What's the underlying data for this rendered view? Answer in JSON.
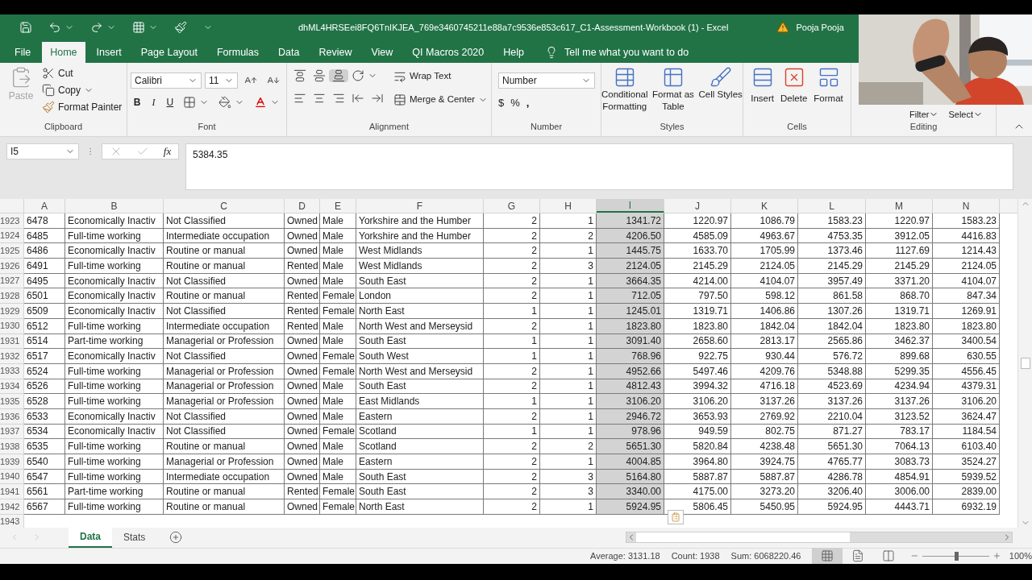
{
  "window": {
    "title": "dhML4HRSEei8FQ6TnIKJEA_769e3460745211e88a7c9536e853c617_C1-Assessment-Workbook (1)  -  Excel",
    "user": "Pooja Pooja"
  },
  "ribbon_tabs": [
    {
      "label": "File",
      "selected": false
    },
    {
      "label": "Home",
      "selected": true
    },
    {
      "label": "Insert",
      "selected": false
    },
    {
      "label": "Page Layout",
      "selected": false
    },
    {
      "label": "Formulas",
      "selected": false
    },
    {
      "label": "Data",
      "selected": false
    },
    {
      "label": "Review",
      "selected": false
    },
    {
      "label": "View",
      "selected": false
    },
    {
      "label": "QI Macros 2020",
      "selected": false
    },
    {
      "label": "Help",
      "selected": false
    }
  ],
  "tell_me": "Tell me what you want to do",
  "clipboard": {
    "paste": {
      "label": "Paste",
      "disabled": true
    },
    "cut": "Cut",
    "copy": "Copy",
    "format_painter": "Format Painter",
    "label": "Clipboard"
  },
  "font": {
    "family": "Calibri",
    "size": "11",
    "bold": "B",
    "italic": "I",
    "underline": "U",
    "label": "Font"
  },
  "alignment": {
    "wrap": "Wrap Text",
    "merge": "Merge & Center",
    "label": "Alignment"
  },
  "number": {
    "format": "Number",
    "currency": "$",
    "percent": "%",
    "comma": ",",
    "label": "Number"
  },
  "styles": {
    "buttons": [
      "Conditional Formatting",
      "Format as Table",
      "Cell Styles"
    ],
    "label": "Styles"
  },
  "cells": {
    "buttons": [
      "Insert",
      "Delete",
      "Format"
    ],
    "label": "Cells"
  },
  "editing": {
    "buttons": [
      "Filter",
      "Select"
    ],
    "label": "Editing"
  },
  "formula_bar": {
    "name_box": "I5",
    "fx": "fx",
    "value": "5384.35"
  },
  "columns": [
    {
      "label": "A",
      "kind": "text",
      "selected": false
    },
    {
      "label": "B",
      "kind": "text",
      "selected": false
    },
    {
      "label": "C",
      "kind": "text",
      "selected": false
    },
    {
      "label": "D",
      "kind": "text",
      "selected": false
    },
    {
      "label": "E",
      "kind": "text",
      "selected": false
    },
    {
      "label": "F",
      "kind": "text",
      "selected": false
    },
    {
      "label": "G",
      "kind": "number",
      "selected": false
    },
    {
      "label": "H",
      "kind": "number",
      "selected": false
    },
    {
      "label": "I",
      "kind": "number",
      "selected": true
    },
    {
      "label": "J",
      "kind": "number",
      "selected": false
    },
    {
      "label": "K",
      "kind": "number",
      "selected": false
    },
    {
      "label": "L",
      "kind": "number",
      "selected": false
    },
    {
      "label": "M",
      "kind": "number",
      "selected": false
    },
    {
      "label": "N",
      "kind": "number",
      "selected": false
    }
  ],
  "rows": [
    {
      "number": "1923",
      "cells": [
        "6478",
        "Economically Inactiv",
        "Not Classified",
        "Owned",
        "Male",
        "Yorkshire and the Humber",
        "2",
        "1",
        "1341.72",
        "1220.97",
        "1086.79",
        "1583.23",
        "1220.97",
        "1583.23"
      ]
    },
    {
      "number": "1924",
      "cells": [
        "6485",
        "Full-time working",
        "Intermediate occupation",
        "Owned",
        "Male",
        "Yorkshire and the Humber",
        "2",
        "2",
        "4206.50",
        "4585.09",
        "4963.67",
        "4753.35",
        "3912.05",
        "4416.83"
      ]
    },
    {
      "number": "1925",
      "cells": [
        "6486",
        "Economically Inactiv",
        "Routine or manual",
        "Owned",
        "Male",
        "West Midlands",
        "2",
        "1",
        "1445.75",
        "1633.70",
        "1705.99",
        "1373.46",
        "1127.69",
        "1214.43"
      ]
    },
    {
      "number": "1926",
      "cells": [
        "6491",
        "Full-time working",
        "Routine or manual",
        "Rented",
        "Male",
        "West Midlands",
        "2",
        "3",
        "2124.05",
        "2145.29",
        "2124.05",
        "2145.29",
        "2145.29",
        "2124.05"
      ]
    },
    {
      "number": "1927",
      "cells": [
        "6495",
        "Economically Inactiv",
        "Not Classified",
        "Owned",
        "Male",
        "South East",
        "2",
        "1",
        "3664.35",
        "4214.00",
        "4104.07",
        "3957.49",
        "3371.20",
        "4104.07"
      ]
    },
    {
      "number": "1928",
      "cells": [
        "6501",
        "Economically Inactiv",
        "Routine or manual",
        "Rented",
        "Female",
        "London",
        "2",
        "1",
        "712.05",
        "797.50",
        "598.12",
        "861.58",
        "868.70",
        "847.34"
      ]
    },
    {
      "number": "1929",
      "cells": [
        "6509",
        "Economically Inactiv",
        "Not Classified",
        "Rented",
        "Female",
        "North East",
        "1",
        "1",
        "1245.01",
        "1319.71",
        "1406.86",
        "1307.26",
        "1319.71",
        "1269.91"
      ]
    },
    {
      "number": "1930",
      "cells": [
        "6512",
        "Full-time working",
        "Intermediate occupation",
        "Rented",
        "Male",
        "North West and Merseysid",
        "2",
        "1",
        "1823.80",
        "1823.80",
        "1842.04",
        "1842.04",
        "1823.80",
        "1823.80"
      ]
    },
    {
      "number": "1931",
      "cells": [
        "6514",
        "Part-time working",
        "Managerial or Profession",
        "Owned",
        "Male",
        "South East",
        "1",
        "1",
        "3091.40",
        "2658.60",
        "2813.17",
        "2565.86",
        "3462.37",
        "3400.54"
      ]
    },
    {
      "number": "1932",
      "cells": [
        "6517",
        "Economically Inactiv",
        "Not Classified",
        "Owned",
        "Female",
        "South West",
        "1",
        "1",
        "768.96",
        "922.75",
        "930.44",
        "576.72",
        "899.68",
        "630.55"
      ]
    },
    {
      "number": "1933",
      "cells": [
        "6524",
        "Full-time working",
        "Managerial or Profession",
        "Owned",
        "Female",
        "North West and Merseysid",
        "2",
        "1",
        "4952.66",
        "5497.46",
        "4209.76",
        "5348.88",
        "5299.35",
        "4556.45"
      ]
    },
    {
      "number": "1934",
      "cells": [
        "6526",
        "Full-time working",
        "Managerial or Profession",
        "Owned",
        "Male",
        "South East",
        "2",
        "1",
        "4812.43",
        "3994.32",
        "4716.18",
        "4523.69",
        "4234.94",
        "4379.31"
      ]
    },
    {
      "number": "1935",
      "cells": [
        "6528",
        "Full-time working",
        "Managerial or Profession",
        "Owned",
        "Male",
        "East Midlands",
        "1",
        "1",
        "3106.20",
        "3106.20",
        "3137.26",
        "3137.26",
        "3137.26",
        "3106.20"
      ]
    },
    {
      "number": "1936",
      "cells": [
        "6533",
        "Economically Inactiv",
        "Not Classified",
        "Owned",
        "Male",
        "Eastern",
        "2",
        "1",
        "2946.72",
        "3653.93",
        "2769.92",
        "2210.04",
        "3123.52",
        "3624.47"
      ]
    },
    {
      "number": "1937",
      "cells": [
        "6534",
        "Economically Inactiv",
        "Not Classified",
        "Owned",
        "Female",
        "Scotland",
        "1",
        "1",
        "978.96",
        "949.59",
        "802.75",
        "871.27",
        "783.17",
        "1184.54"
      ]
    },
    {
      "number": "1938",
      "cells": [
        "6535",
        "Full-time working",
        "Routine or manual",
        "Owned",
        "Male",
        "Scotland",
        "2",
        "2",
        "5651.30",
        "5820.84",
        "4238.48",
        "5651.30",
        "7064.13",
        "6103.40"
      ]
    },
    {
      "number": "1939",
      "cells": [
        "6540",
        "Full-time working",
        "Managerial or Profession",
        "Owned",
        "Male",
        "Eastern",
        "2",
        "1",
        "4004.85",
        "3964.80",
        "3924.75",
        "4765.77",
        "3083.73",
        "3524.27"
      ]
    },
    {
      "number": "1940",
      "cells": [
        "6547",
        "Full-time working",
        "Intermediate occupation",
        "Owned",
        "Male",
        "South East",
        "2",
        "3",
        "5164.80",
        "5887.87",
        "5887.87",
        "4286.78",
        "4854.91",
        "5939.52"
      ]
    },
    {
      "number": "1941",
      "cells": [
        "6561",
        "Part-time working",
        "Routine or manual",
        "Rented",
        "Female",
        "South East",
        "2",
        "3",
        "3340.00",
        "4175.00",
        "3273.20",
        "3206.40",
        "3006.00",
        "2839.00"
      ]
    },
    {
      "number": "1942",
      "cells": [
        "6567",
        "Full-time working",
        "Routine or manual",
        "Owned",
        "Female",
        "North East",
        "2",
        "1",
        "5924.95",
        "5806.45",
        "5450.95",
        "5924.95",
        "4443.71",
        "6932.19"
      ]
    }
  ],
  "next_row_number": "1943",
  "sheet_tabs": [
    {
      "label": "Data",
      "selected": true
    },
    {
      "label": "Stats",
      "selected": false
    }
  ],
  "status_bar": {
    "average": "Average: 3131.18",
    "count": "Count: 1938",
    "sum": "Sum: 6068220.46",
    "views": [
      {
        "kind": "normal",
        "selected": true
      },
      {
        "kind": "page_layout",
        "selected": false
      },
      {
        "kind": "page_break",
        "selected": false
      }
    ],
    "zoom": {
      "label": "100%",
      "level": 0.5
    }
  }
}
